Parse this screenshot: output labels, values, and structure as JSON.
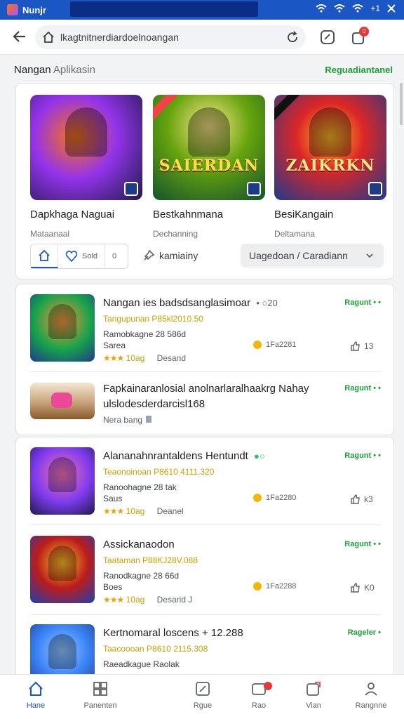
{
  "status_bar": {
    "app_title": "Nunjr",
    "battery": "+1"
  },
  "address_bar": {
    "url": "lkagtnitnerdiardoelnoangan",
    "notif_count": "0"
  },
  "section": {
    "title_main": "Nangan",
    "title_sub": "Aplikasin",
    "link": "Reguadiantanel"
  },
  "featured": [
    {
      "name": "Dapkhaga Naguai",
      "category": "Mataanaal",
      "logo": ""
    },
    {
      "name": "Bestkahnmana",
      "category": "Dechanning",
      "logo": "SAIERDAN"
    },
    {
      "name": "BesiKangain",
      "category": "Deltamana",
      "logo": "ZAIKRKN"
    }
  ],
  "filters": {
    "seg2": "Sold",
    "seg3": "0"
  },
  "tag": "kamiainy",
  "dropdown": "Uagedoan / Caradiann",
  "list1": [
    {
      "title": "Nangan ies badsdsanglasimoar",
      "title_extra": "• ○20",
      "price": "Tangupunan  P85kl2010.50",
      "meta1": "Ramobkagne  28 586d",
      "meta2": "Sarea",
      "stars": "★★★",
      "score": "10ag",
      "rating_label": "Desand",
      "action": "Ragunt • •",
      "info": "1Fa2281",
      "likes": "13"
    },
    {
      "title": "Fapkainaranlosial anolnarlaralhaakrg Nahay",
      "title_line2": "ulslodesderdarcisl168",
      "meta1": "Nera bang",
      "action": "Ragunt • •"
    }
  ],
  "list2": [
    {
      "title": "Alananahnrantaldens Hentundt",
      "title_extra": "●○",
      "price": "Teaonoinoan  P8610 4111.320",
      "meta1": "Ranoohagne  28 tak",
      "meta2": "Saus",
      "stars": "★★★",
      "score": "10ag",
      "rating_label": "Deanel",
      "action": "Ragunt • •",
      "info": "1Fa2280",
      "likes": "k3"
    },
    {
      "title": "Assickanaodon",
      "price": "Taataman  P88KJ28V.088",
      "meta1": "Ranodkagne  28 66d",
      "meta2": "Boes",
      "stars": "★★★",
      "score": "10ag",
      "rating_label": "Desarid J",
      "action": "Ragunt • •",
      "info": "1Fa2288",
      "likes": "K0"
    },
    {
      "title": "Kertnomaral loscens  + 12.288",
      "price": "Taacoooan  P8610 2115.308",
      "meta1": "Raeadkague  Raolak",
      "action": "Rageler •"
    }
  ],
  "bottom_nav": [
    {
      "label": "Hane"
    },
    {
      "label": "Panenten"
    },
    {
      "label": "Rgue"
    },
    {
      "label": "Rao"
    },
    {
      "label": "Vian"
    },
    {
      "label": "Rangnne"
    }
  ]
}
